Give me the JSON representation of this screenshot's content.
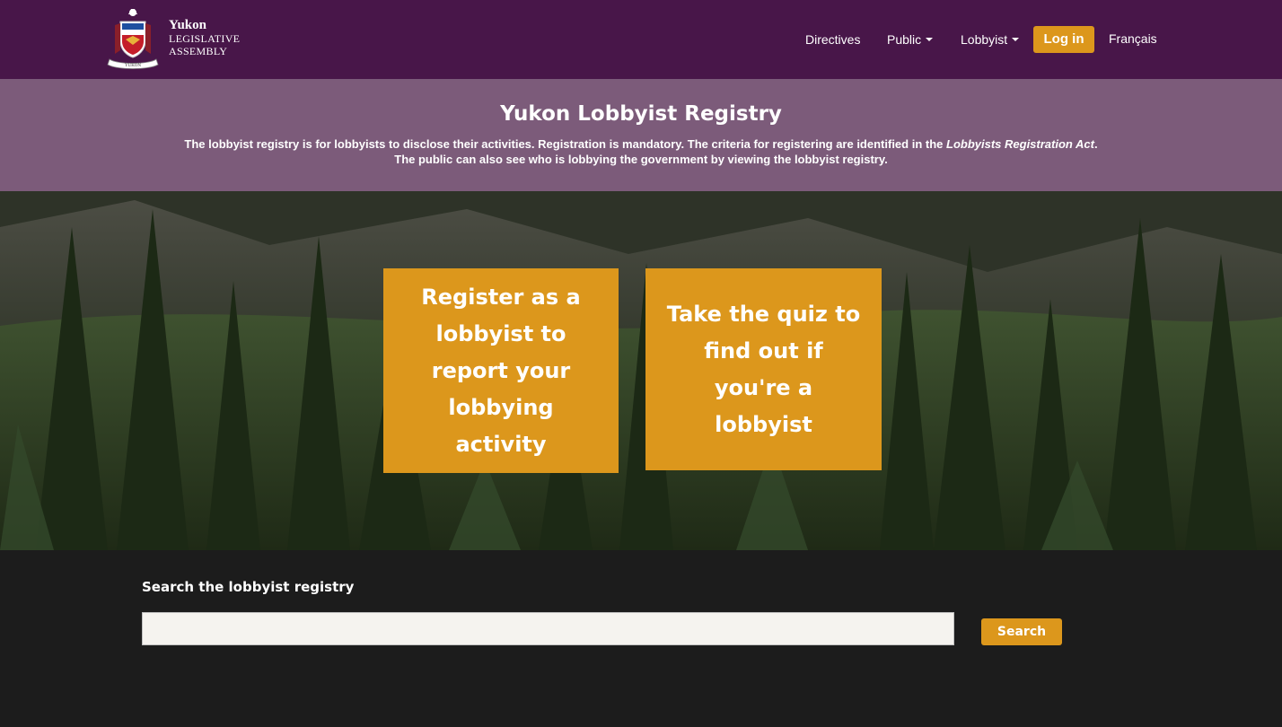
{
  "header": {
    "logo_name": "Yukon",
    "logo_subtitle": "LEGISLATIVE ASSEMBLY",
    "crest_ribbon_text": "YUKON",
    "nav": {
      "directives": "Directives",
      "public": "Public",
      "lobbyist": "Lobbyist",
      "login": "Log in",
      "language": "Français"
    }
  },
  "banner": {
    "title": "Yukon Lobbyist Registry",
    "desc_part1": "The lobbyist registry is for lobbyists to disclose their activities. Registration is mandatory. The criteria for registering are identified in the ",
    "desc_italic": "Lobbyists Registration Act",
    "desc_part2": ". The public can also see who is lobbying the government by viewing the lobbyist registry."
  },
  "hero": {
    "register_cta": "Register as a lobbyist to report your lobbying activity",
    "quiz_cta": "Take the quiz to find out if you're a lobbyist"
  },
  "search": {
    "label": "Search the lobbyist registry",
    "value": "",
    "button": "Search"
  },
  "colors": {
    "header_bg": "#481649",
    "banner_bg": "#7c5b7a",
    "accent": "#dc971c",
    "footer_bg": "#1c1c1c"
  }
}
